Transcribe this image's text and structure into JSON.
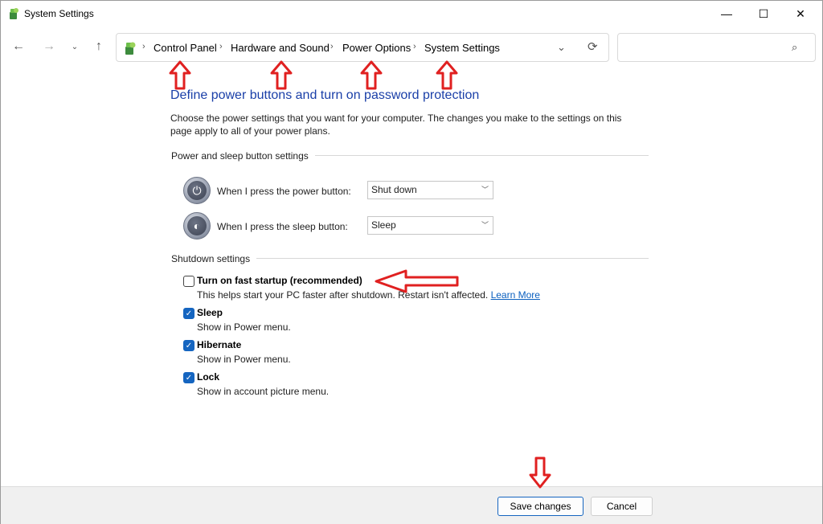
{
  "window": {
    "title": "System Settings",
    "controls": {
      "minimize": "—",
      "maximize": "☐",
      "close": "✕"
    }
  },
  "nav": {
    "back": "←",
    "forward": "→",
    "recent": "⌄",
    "up": "↑"
  },
  "breadcrumb": {
    "items": [
      "Control Panel",
      "Hardware and Sound",
      "Power Options",
      "System Settings"
    ],
    "separator": "›"
  },
  "search": {
    "placeholder": "",
    "icon": "search-icon"
  },
  "page": {
    "title": "Define power buttons and turn on password protection",
    "intro": "Choose the power settings that you want for your computer. The changes you make to the settings on this page apply to all of your power plans."
  },
  "power_group": {
    "label": "Power and sleep button settings",
    "rows": [
      {
        "label": "When I press the power button:",
        "value": "Shut down",
        "icon": "power-button-icon"
      },
      {
        "label": "When I press the sleep button:",
        "value": "Sleep",
        "icon": "sleep-button-icon"
      }
    ]
  },
  "shutdown_group": {
    "label": "Shutdown settings",
    "items": [
      {
        "label": "Turn on fast startup (recommended)",
        "checked": false,
        "desc": "This helps start your PC faster after shutdown. Restart isn't affected.",
        "link": "Learn More"
      },
      {
        "label": "Sleep",
        "checked": true,
        "desc": "Show in Power menu."
      },
      {
        "label": "Hibernate",
        "checked": true,
        "desc": "Show in Power menu."
      },
      {
        "label": "Lock",
        "checked": true,
        "desc": "Show in account picture menu."
      }
    ]
  },
  "footer": {
    "save_label": "Save changes",
    "cancel_label": "Cancel"
  },
  "colors": {
    "title_blue": "#1a3fa8",
    "accent": "#1565c0",
    "annotation_arrow": "#e02020",
    "link": "#0a5fbf"
  }
}
